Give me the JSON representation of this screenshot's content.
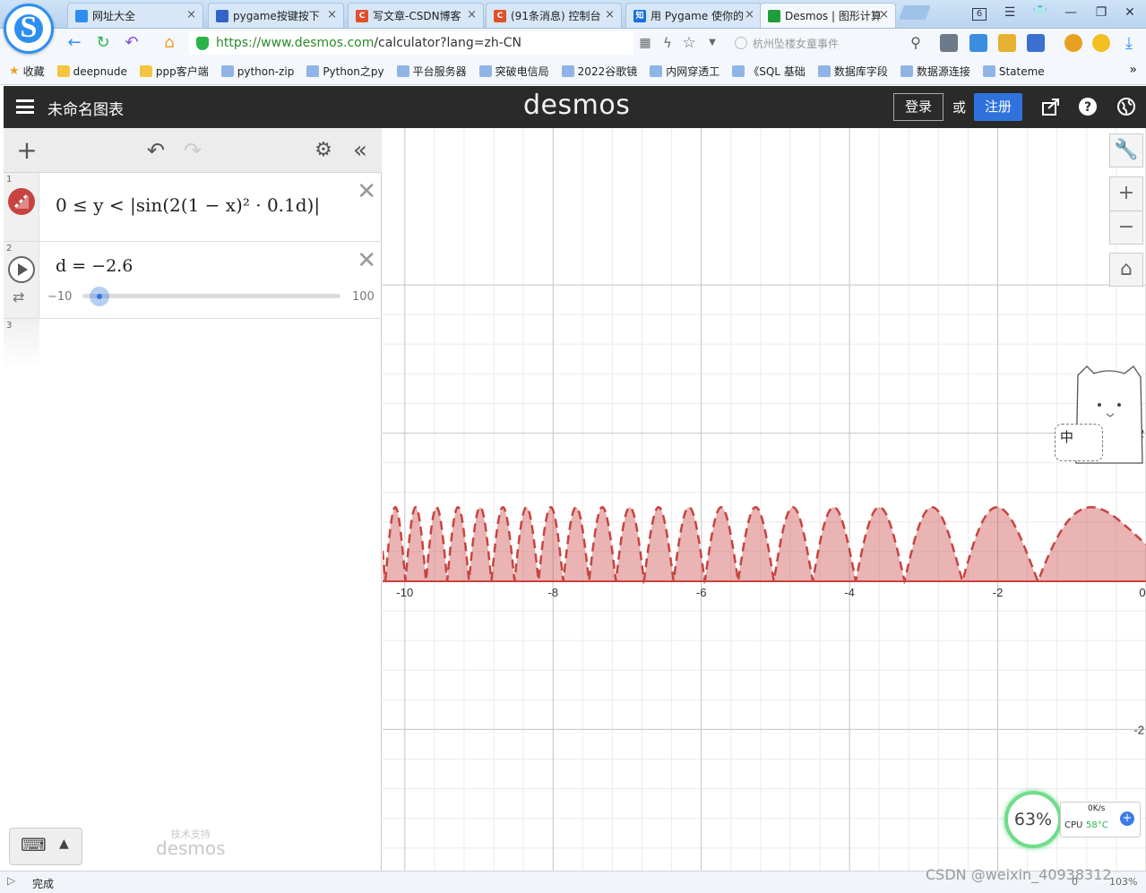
{
  "browser": {
    "tabs": [
      {
        "title": "网址大全",
        "color": "#2e8ef0",
        "glyph": ""
      },
      {
        "title": "pygame按键按下",
        "color": "#3264c8",
        "glyph": ""
      },
      {
        "title": "写文章-CSDN博客",
        "color": "#e0502a",
        "glyph": "C"
      },
      {
        "title": "(91条消息) 控制台",
        "color": "#e0502a",
        "glyph": "C"
      },
      {
        "title": "用 Pygame 使你的",
        "color": "#1a6fd8",
        "glyph": "知"
      },
      {
        "title": "Desmos | 图形计算",
        "color": "#1e9e3a",
        "glyph": ""
      }
    ],
    "tab_close": "×",
    "window_badge": "6",
    "url": "https://www.desmos.com/calculator?lang=zh-CN",
    "url_host": "https://www.desmos.com",
    "url_path": "/calculator?lang=zh-CN",
    "search_placeholder": "杭州坠楼女童事件",
    "bookmarks": [
      {
        "label": "收藏",
        "kind": "star"
      },
      {
        "label": "deepnude",
        "kind": "folder"
      },
      {
        "label": "ppp客户端",
        "kind": "folder"
      },
      {
        "label": "python-zip",
        "kind": "link"
      },
      {
        "label": "Python之py",
        "kind": "link"
      },
      {
        "label": "平台服务器",
        "kind": "link"
      },
      {
        "label": "突破电信局",
        "kind": "link"
      },
      {
        "label": "2022谷歌镜",
        "kind": "link"
      },
      {
        "label": "内网穿透工",
        "kind": "link"
      },
      {
        "label": "《SQL 基础",
        "kind": "link"
      },
      {
        "label": "数据库字段",
        "kind": "link"
      },
      {
        "label": "数据源连接",
        "kind": "link"
      },
      {
        "label": "Stateme",
        "kind": "link"
      }
    ],
    "bookmarks_more": "»"
  },
  "desmos": {
    "graph_title": "未命名图表",
    "logo": "desmos",
    "login_label": "登录",
    "or_label": "或",
    "signup_label": "注册",
    "expressions": [
      {
        "index": "1",
        "latex": "0 ≤ y < |sin(2(1 − x)² · 0.1d)|",
        "color": "#c74440"
      },
      {
        "index": "2",
        "latex": "d = −2.6",
        "variable": "d",
        "value": -2.6,
        "slider_min": "−10",
        "slider_max": "100",
        "slider_fraction": 0.067
      },
      {
        "index": "3",
        "latex": ""
      }
    ],
    "powered_by_caption": "技术支持",
    "powered_by_logo": "desmos"
  },
  "graph": {
    "x_range": [
      -10.3,
      0.0
    ],
    "y_origin_label": "0",
    "x_ticks": [
      "-10",
      "-8",
      "-6",
      "-4",
      "-2",
      "0"
    ],
    "y_ticks": [
      "2",
      "-2"
    ],
    "fill_color": "#c74440",
    "expression": {
      "d": -2.6,
      "k": 0.1
    }
  },
  "overlay": {
    "input_method_label": "中",
    "cpu_percent": "63%",
    "net_speed": "0K/s",
    "cpu_temp_label": "CPU",
    "cpu_temp": "58°C"
  },
  "statusbar": {
    "status": "完成",
    "watermark": "CSDN @weixin_40938312",
    "zoom": "103%",
    "count": "0"
  }
}
